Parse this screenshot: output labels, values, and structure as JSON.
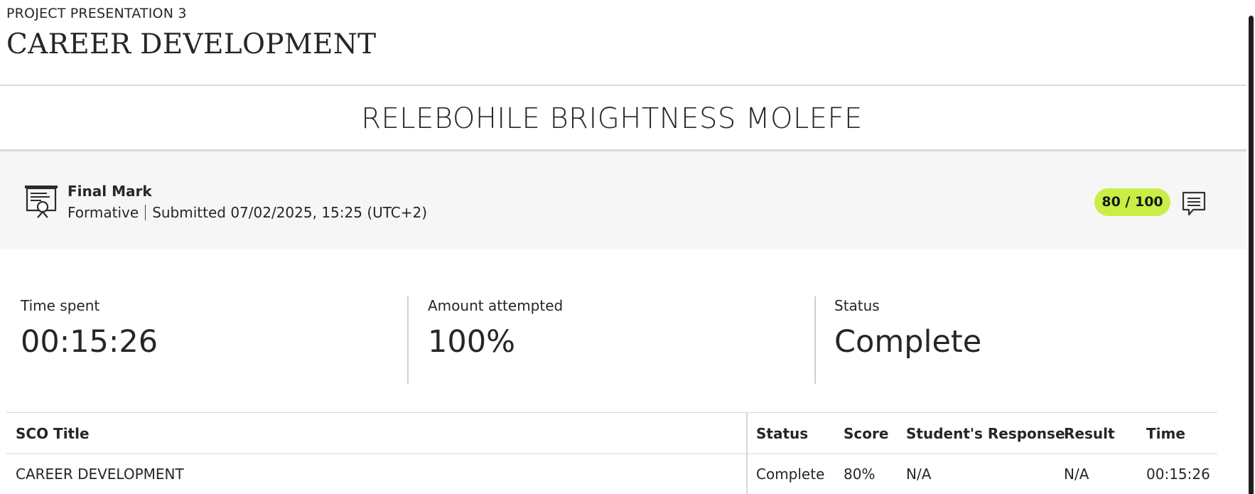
{
  "header": {
    "kicker": "PROJECT PRESENTATION 3",
    "course_title": "CAREER DEVELOPMENT"
  },
  "student": {
    "name": "RELEBOHILE BRIGHTNESS MOLEFE"
  },
  "final_mark": {
    "label": "Final Mark",
    "type": "Formative",
    "submitted": "Submitted 07/02/2025, 15:25 (UTC+2)",
    "score": "80 / 100",
    "score_color": "#c9ee46",
    "icon": "certificate-icon",
    "comment_icon": "comment-icon"
  },
  "stats": {
    "time_spent": {
      "label": "Time spent",
      "value": "00:15:26"
    },
    "amount_attempted": {
      "label": "Amount attempted",
      "value": "100%"
    },
    "status": {
      "label": "Status",
      "value": "Complete"
    }
  },
  "table": {
    "headers": {
      "sco_title": "SCO Title",
      "status": "Status",
      "score": "Score",
      "response": "Student's Response",
      "result": "Result",
      "time": "Time"
    },
    "rows": [
      {
        "sco_title": "CAREER DEVELOPMENT",
        "status": "Complete",
        "score": "80%",
        "response": "N/A",
        "result": "N/A",
        "time": "00:15:26"
      }
    ]
  }
}
